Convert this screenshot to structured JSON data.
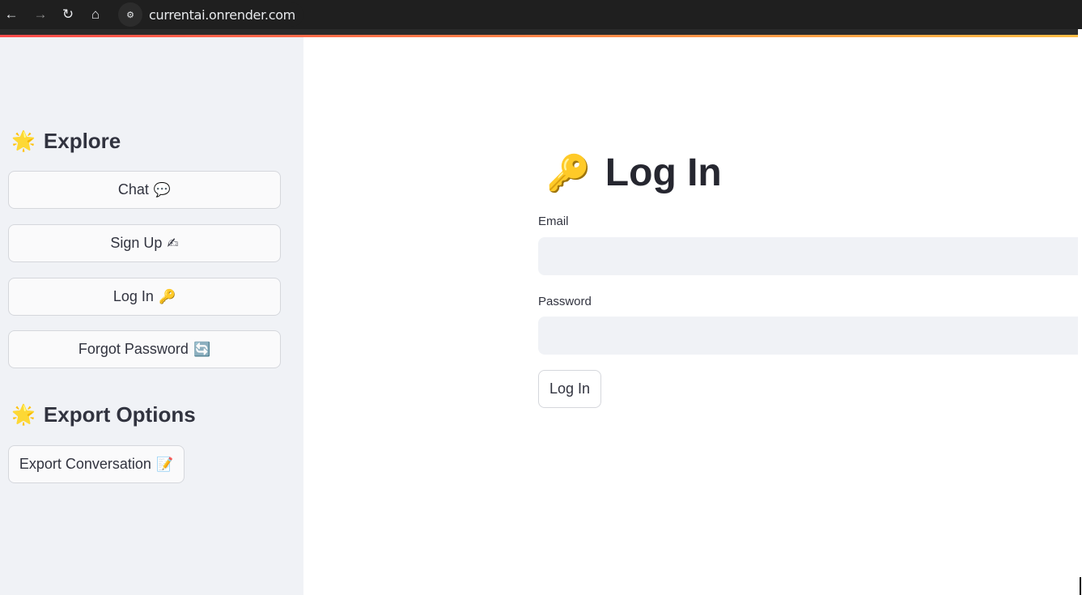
{
  "browser": {
    "back_icon": "arrow-left-icon",
    "forward_icon": "arrow-right-icon",
    "reload_icon": "reload-icon",
    "home_icon": "home-icon",
    "site_info_icon": "tune-icon",
    "url": "currentai.onrender.com"
  },
  "sidebar": {
    "explore_heading": "Explore",
    "explore_emoji": "🌟",
    "items": [
      {
        "label": "Chat",
        "emoji": "💬"
      },
      {
        "label": "Sign Up",
        "emoji": "✍"
      },
      {
        "label": "Log In",
        "emoji": "🔑"
      },
      {
        "label": "Forgot Password",
        "emoji": "🔄"
      }
    ],
    "export_heading": "Export Options",
    "export_emoji": "🌟",
    "export_button": {
      "label": "Export Conversation",
      "emoji": "📝"
    }
  },
  "main": {
    "title": "Log In",
    "title_emoji": "🔑",
    "email_label": "Email",
    "email_value": "",
    "password_label": "Password",
    "password_value": "",
    "submit_label": "Log In"
  },
  "colors": {
    "accent_gradient_start": "#ff4b4b",
    "accent_gradient_end": "#ffbd45",
    "sidebar_bg": "#f0f2f6",
    "input_bg": "#f0f2f6"
  }
}
